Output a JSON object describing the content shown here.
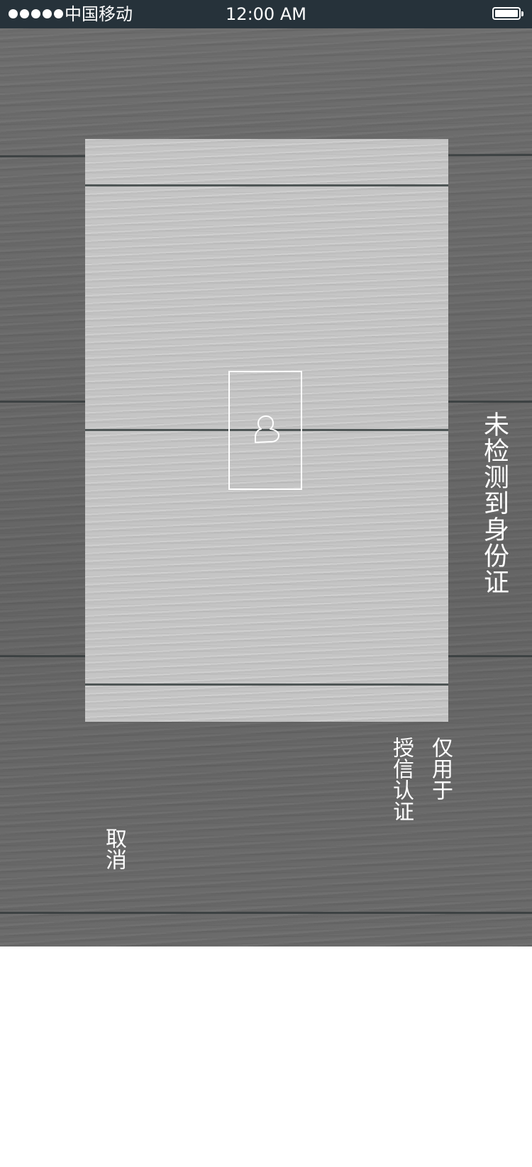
{
  "status_bar": {
    "carrier": "中国移动",
    "time": "12:00 AM",
    "signal_icon": "signal-dots-icon",
    "battery_icon": "battery-full-icon"
  },
  "camera": {
    "guide_icon": "face-outline-icon",
    "status_text": "未检测到身份证",
    "hint_line1": "仅用于",
    "hint_line2": "授信认证",
    "cancel_label": "取消"
  },
  "colors": {
    "status_bar_bg": "#26323a",
    "overlay_bg": "#6a6a6a",
    "frame_bg": "#c5c5c5",
    "text": "#ffffff"
  }
}
